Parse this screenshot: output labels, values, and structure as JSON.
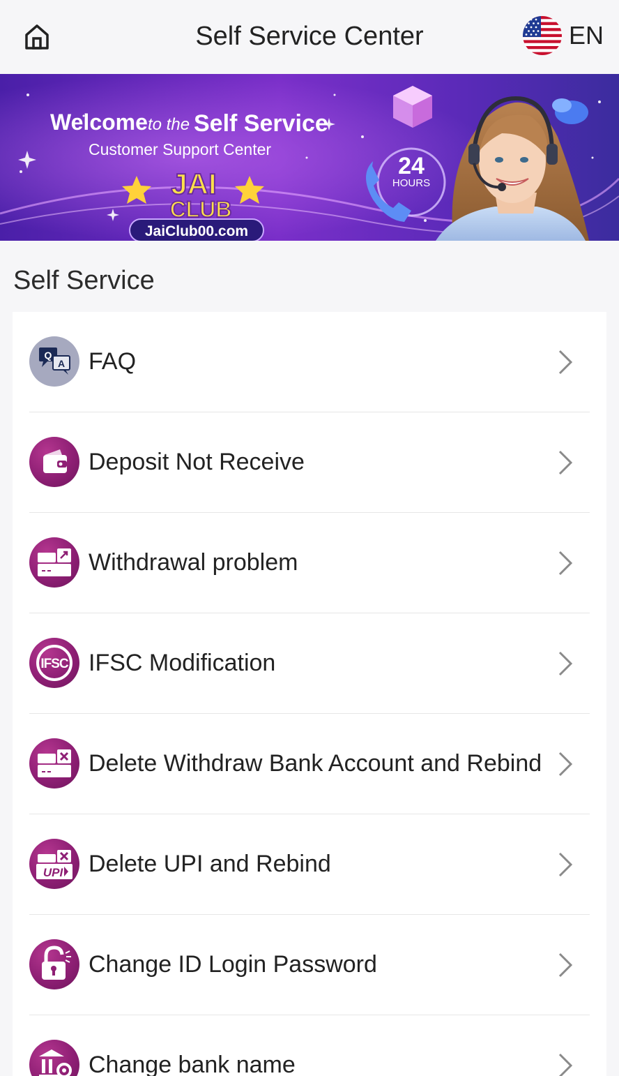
{
  "header": {
    "title": "Self Service Center",
    "home_icon": "home-icon",
    "language": "EN",
    "flag_icon": "us-flag-icon"
  },
  "banner": {
    "line1_a": "Welcome",
    "line1_b": "to the",
    "line1_c": "Self Service",
    "line2": "Customer Support Center",
    "brand_top": "JAI",
    "brand_bottom": "CLUB",
    "site": "JaiClub00.com",
    "hours_number": "24",
    "hours_label": "HOURS"
  },
  "section": {
    "title": "Self Service"
  },
  "items": [
    {
      "label": "FAQ",
      "icon": "faq-icon"
    },
    {
      "label": "Deposit Not Receive",
      "icon": "wallet-icon"
    },
    {
      "label": "Withdrawal problem",
      "icon": "withdraw-card-icon"
    },
    {
      "label": "IFSC Modification",
      "icon": "ifsc-icon"
    },
    {
      "label": "Delete Withdraw Bank Account and Rebind",
      "icon": "delete-card-icon"
    },
    {
      "label": "Delete UPI and Rebind",
      "icon": "delete-upi-icon",
      "icon_text": "UPI"
    },
    {
      "label": "Change ID Login Password",
      "icon": "lock-icon"
    },
    {
      "label": "Change bank name",
      "icon": "bank-settings-icon"
    }
  ],
  "colors": {
    "accent": "#8e1f74",
    "faq_icon_bg": "#a6a9bf",
    "background": "#f6f6f8"
  }
}
